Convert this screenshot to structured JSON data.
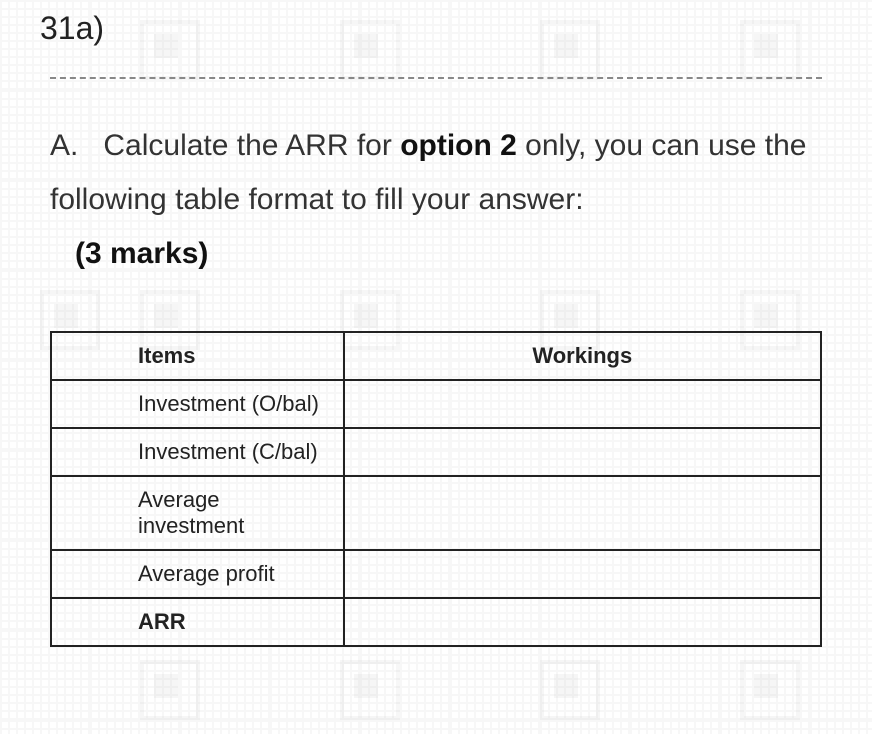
{
  "question_number": "31a)",
  "question": {
    "part_label": "A.",
    "text_before_bold": "Calculate the ARR for ",
    "bold_text": "option 2",
    "text_after_bold": " only, you can use the following table format to fill your answer:",
    "marks": "(3 marks)"
  },
  "table": {
    "headers": {
      "col1": "Items",
      "col2": "Workings"
    },
    "rows": [
      {
        "items": "Investment (O/bal)",
        "workings": "",
        "bold": false
      },
      {
        "items": "Investment (C/bal)",
        "workings": "",
        "bold": false
      },
      {
        "items": "Average investment",
        "workings": "",
        "bold": false
      },
      {
        "items": "Average profit",
        "workings": "",
        "bold": false
      },
      {
        "items": "ARR",
        "workings": "",
        "bold": true
      }
    ]
  }
}
